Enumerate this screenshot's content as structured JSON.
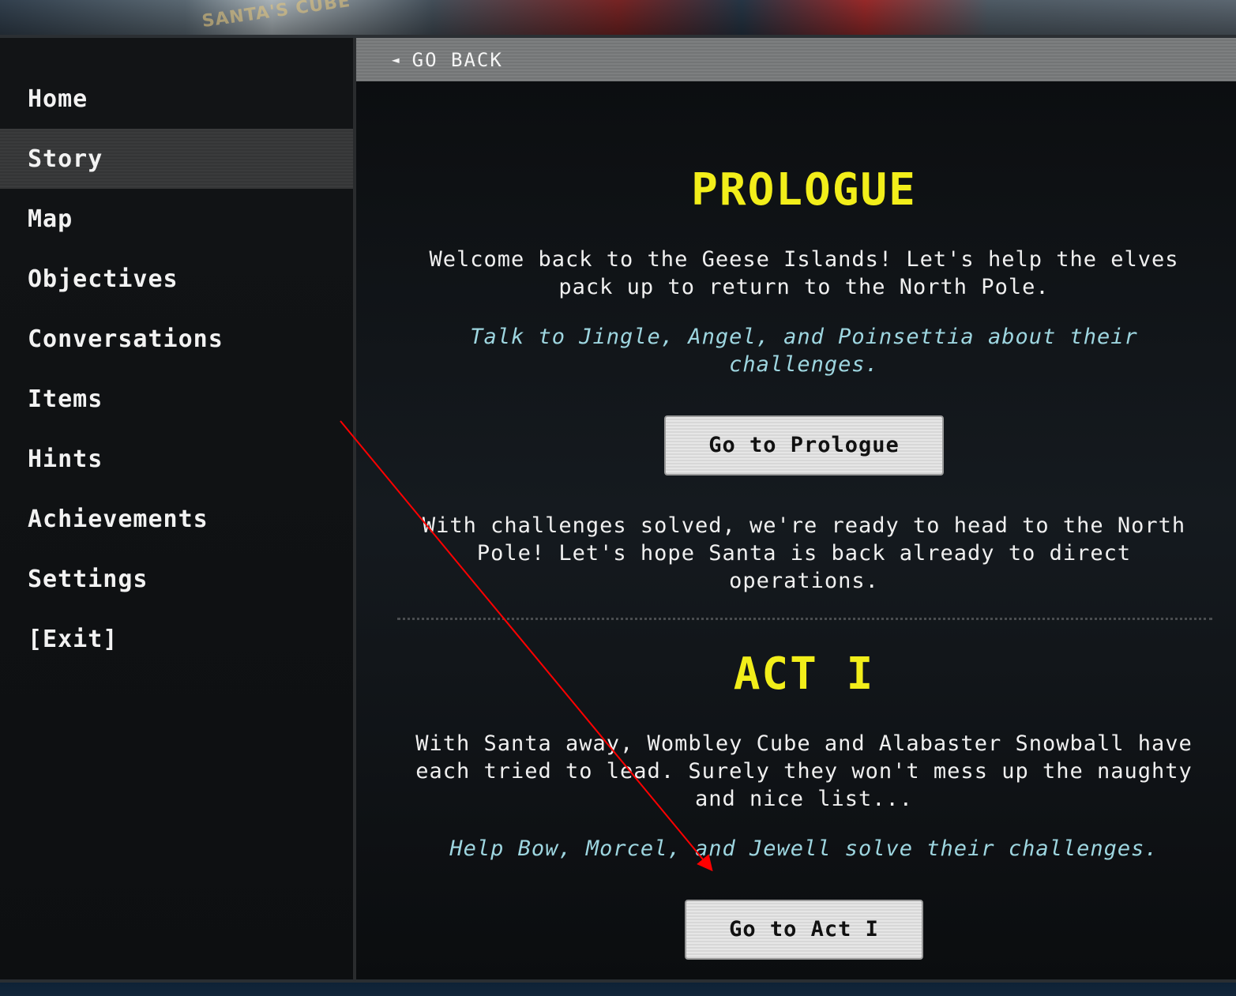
{
  "banner": {
    "logo_text": "SANTA'S CUBE"
  },
  "sidebar": {
    "items": [
      {
        "label": "Home"
      },
      {
        "label": "Story"
      },
      {
        "label": "Map"
      },
      {
        "label": "Objectives"
      },
      {
        "label": "Conversations"
      },
      {
        "label": "Items"
      },
      {
        "label": "Hints"
      },
      {
        "label": "Achievements"
      },
      {
        "label": "Settings"
      },
      {
        "label": "[Exit]"
      }
    ],
    "active": "Story"
  },
  "header": {
    "back_arrow": "◄",
    "back_label": "GO BACK"
  },
  "prologue": {
    "title": "PROLOGUE",
    "intro": "Welcome back to the Geese Islands! Let's help the elves pack up to return to the North Pole.",
    "task": "Talk to Jingle, Angel, and Poinsettia about their challenges.",
    "button_label": "Go to Prologue",
    "outro": "With challenges solved, we're ready to head to the North Pole! Let's hope Santa is back already to direct operations."
  },
  "act1": {
    "title": "ACT I",
    "intro": "With Santa away, Wombley Cube and Alabaster Snowball have each tried to lead. Surely they won't mess up the naughty and nice list...",
    "task": "Help Bow, Morcel, and Jewell solve their challenges.",
    "button_label": "Go to Act I"
  },
  "colors": {
    "title_yellow": "#f2ee1a",
    "hint_cyan": "#9ed6e0",
    "annotation_red": "#ff0000"
  }
}
